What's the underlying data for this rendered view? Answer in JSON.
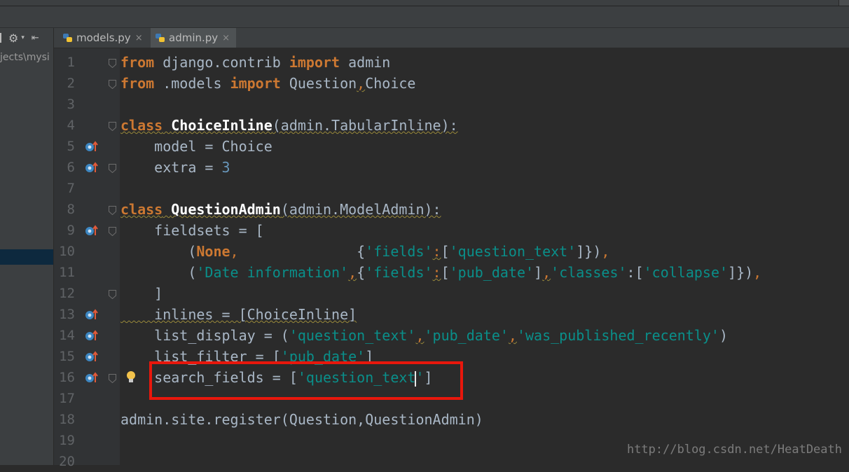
{
  "project": {
    "path_fragment": "jects\\mysi",
    "toolbar_icons": [
      "split-icon",
      "gear-icon",
      "collapse-icon"
    ]
  },
  "tabs": [
    {
      "label": "models.py",
      "icon": "python-file-icon",
      "active": false,
      "close": "×"
    },
    {
      "label": "admin.py",
      "icon": "python-file-icon",
      "active": true,
      "close": "×"
    }
  ],
  "editor": {
    "line_numbers": [
      "1",
      "2",
      "3",
      "4",
      "5",
      "6",
      "7",
      "8",
      "9",
      "10",
      "11",
      "12",
      "13",
      "14",
      "15",
      "16",
      "17",
      "18",
      "19",
      "20"
    ],
    "lines": [
      [
        "from",
        " django.contrib ",
        "import",
        " admin"
      ],
      [
        "from",
        " .models ",
        "import",
        " Question",
        ",",
        "Choice"
      ],
      [],
      [
        "class",
        " ",
        "ChoiceInline",
        "(admin.TabularInline):"
      ],
      [
        "    model = Choice"
      ],
      [
        "    extra = ",
        "3"
      ],
      [],
      [
        "class",
        " ",
        "QuestionAdmin",
        "(admin.ModelAdmin):"
      ],
      [
        "    fieldsets = ["
      ],
      [
        "        (",
        "None",
        ",",
        "              {",
        "'fields'",
        ":",
        "[",
        "'question_text'",
        "]}",
        ")",
        ","
      ],
      [
        "        (",
        "'Date information'",
        ",",
        "{",
        "'fields'",
        ":",
        "[",
        "'pub_date'",
        "]",
        ",",
        "'classes'",
        ":",
        "[",
        "'collapse'",
        "]})",
        ","
      ],
      [
        "    ]"
      ],
      [
        "    inlines = [ChoiceInline]"
      ],
      [
        "    list_display = (",
        "'question_text'",
        ",",
        "'pub_date'",
        ",",
        "'was_published_recently'",
        ")"
      ],
      [
        "    list_filter = [",
        "'pub_date'",
        "]"
      ],
      [
        "    search_fields = [",
        "'question_text",
        "'",
        "]"
      ],
      [],
      [
        "admin.site.register(Question",
        ",",
        "QuestionAdmin)"
      ],
      [],
      []
    ],
    "override_marker_lines": [
      5,
      6,
      9,
      13,
      14,
      15,
      16
    ],
    "fold_marker_lines": [
      1,
      2,
      4,
      6,
      8,
      9,
      12,
      16
    ],
    "bulb_line": 16,
    "highlighted_line": 16
  },
  "watermark": "http://blog.csdn.net/HeatDeath",
  "colors": {
    "keyword": "#cc7832",
    "string": "#0a8f8a",
    "number": "#6897bb",
    "text": "#a9b7c6",
    "highlight_box": "#e8170c"
  }
}
